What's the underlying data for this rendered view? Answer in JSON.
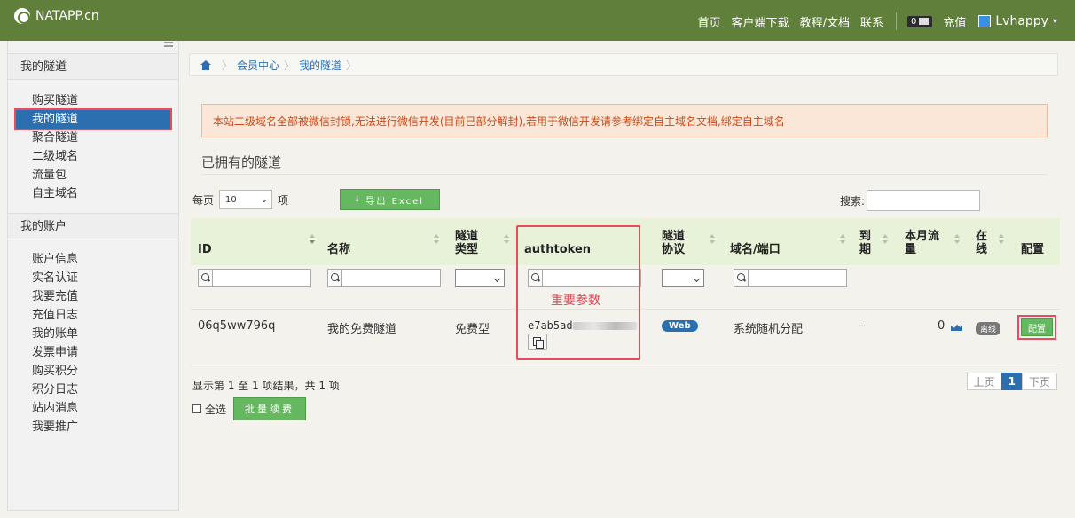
{
  "brand": {
    "name": "NATAPP.cn"
  },
  "topnav": {
    "home": "首页",
    "client_download": "客户端下载",
    "docs": "教程/文档",
    "contact": "联系",
    "message_count": "0",
    "recharge": "充值",
    "username": "Lvhappy"
  },
  "sidebar": {
    "tunnels_header": "我的隧道",
    "tunnel_items": [
      "购买隧道",
      "我的隧道",
      "聚合隧道",
      "二级域名",
      "流量包",
      "自主域名"
    ],
    "account_header": "我的账户",
    "account_items": [
      "账户信息",
      "实名认证",
      "我要充值",
      "充值日志",
      "我的账单",
      "发票申请",
      "购买积分",
      "积分日志",
      "站内消息",
      "我要推广"
    ]
  },
  "breadcrumb": {
    "home": "会员中心",
    "current": "我的隧道"
  },
  "alert": "本站二级域名全部被微信封锁,无法进行微信开发(目前已部分解封),若用于微信开发请参考绑定自主域名文档,绑定自主域名",
  "section_title": "已拥有的隧道",
  "controls": {
    "per_page_label": "每页",
    "per_page_value": "10",
    "per_page_suffix": "项",
    "export_label": "导出 Excel",
    "search_label": "搜索:"
  },
  "table": {
    "headers": {
      "id": "ID",
      "name": "名称",
      "type": "隧道类型",
      "authtoken": "authtoken",
      "protocol": "隧道协议",
      "domain": "域名/端口",
      "expire": "到期",
      "traffic": "本月流量",
      "online": "在线",
      "config": "配置"
    },
    "hint": "重要参数",
    "rows": [
      {
        "id": "06q5ww796q",
        "name": "我的免费隧道",
        "type": "免费型",
        "authtoken_visible": "e7ab5ad",
        "protocol": "Web",
        "domain": "系统随机分配",
        "expire": "-",
        "traffic": "0",
        "online": "离线",
        "config": "配置"
      }
    ]
  },
  "footer": {
    "info": "显示第 1 至 1 项结果，共 1 项",
    "select_all": "全选",
    "batch_renew": "批量续费",
    "prev": "上页",
    "page": "1",
    "next": "下页"
  },
  "colors": {
    "topbar": "#5f7f3a",
    "accent_blue": "#2c6fb0",
    "green_button": "#65b860",
    "highlight_red": "#e74c5a"
  }
}
